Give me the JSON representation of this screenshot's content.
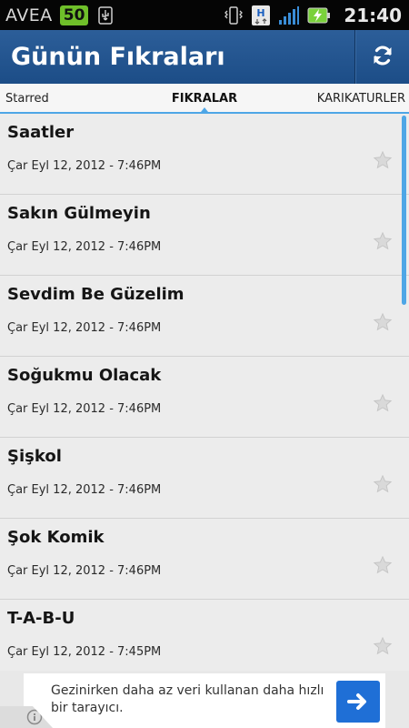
{
  "status_bar": {
    "carrier": "AVEA",
    "notification_count": "50",
    "time": "21:40",
    "icons": [
      "usb-icon",
      "vibrate-icon",
      "hspa-icon",
      "signal-icon",
      "battery-charging-icon"
    ]
  },
  "action_bar": {
    "title": "Günün Fıkraları",
    "refresh_icon": "refresh-icon",
    "color": "#1f4f8a"
  },
  "tabs": {
    "left": "Starred",
    "active": "FIKRALAR",
    "right": "KARIKATURLER",
    "indicator_color": "#4ea6e6"
  },
  "items": [
    {
      "title": "Saatler",
      "date": "Çar Eyl 12, 2012 - 7:46PM"
    },
    {
      "title": "Sakın Gülmeyin",
      "date": "Çar Eyl 12, 2012 - 7:46PM"
    },
    {
      "title": "Sevdim Be Güzelim",
      "date": "Çar Eyl 12, 2012 - 7:46PM"
    },
    {
      "title": "Soğukmu Olacak",
      "date": "Çar Eyl 12, 2012 - 7:46PM"
    },
    {
      "title": "Şişkol",
      "date": "Çar Eyl 12, 2012 - 7:46PM"
    },
    {
      "title": "Şok Komik",
      "date": "Çar Eyl 12, 2012 - 7:46PM"
    },
    {
      "title": "T-A-B-U",
      "date": "Çar Eyl 12, 2012 - 7:45PM"
    }
  ],
  "ad": {
    "text": "Gezinirken daha az veri kullanan daha hızlı bir tarayıcı.",
    "button_icon": "arrow-right-icon",
    "button_color": "#1f6fd6"
  }
}
